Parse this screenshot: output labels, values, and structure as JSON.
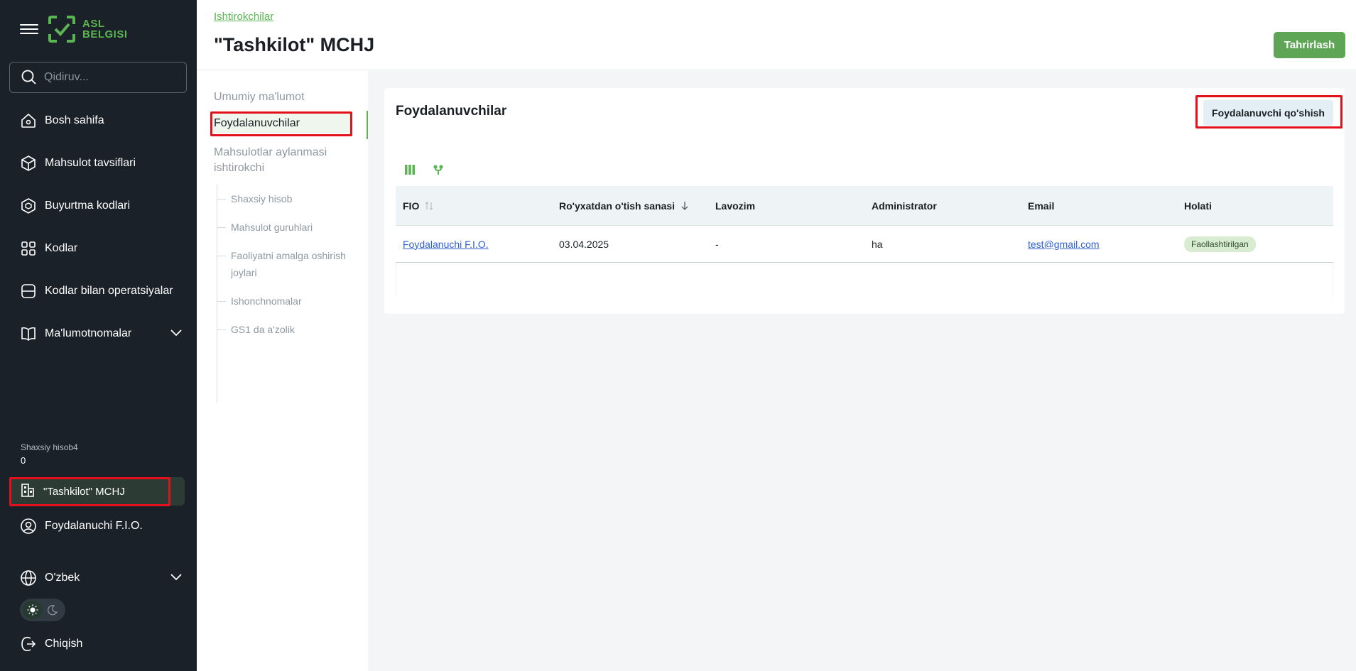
{
  "app": {
    "logo_text_1": "ASL",
    "logo_text_2": "BELGISI",
    "brand_color": "#5ab552"
  },
  "sidebar": {
    "search_placeholder": "Qidiruv...",
    "items": [
      {
        "label": "Bosh sahifa",
        "icon": "home-icon"
      },
      {
        "label": "Mahsulot tavsiflari",
        "icon": "cube-icon"
      },
      {
        "label": "Buyurtma kodlari",
        "icon": "package-icon"
      },
      {
        "label": "Kodlar",
        "icon": "qr-icon"
      },
      {
        "label": "Kodlar bilan operatsiyalar",
        "icon": "database-icon"
      },
      {
        "label": "Ma'lumotnomalar",
        "icon": "book-icon"
      }
    ],
    "account_title": "Shaxsiy hisob4",
    "account_value": "0",
    "org_label": "\"Tashkilot\" MCHJ",
    "user_label": "Foydalanuchi F.I.O.",
    "language_label": "O'zbek",
    "logout_label": "Chiqish"
  },
  "header": {
    "breadcrumb": "Ishtirokchilar",
    "title": "\"Tashkilot\" MCHJ",
    "edit_button": "Tahrirlash"
  },
  "subnav": {
    "items": [
      "Umumiy ma'lumot",
      "Foydalanuvchilar",
      "Mahsulotlar aylanmasi",
      "ishtirokchi"
    ],
    "sub_items": [
      "Shaxsiy hisob",
      "Mahsulot guruhlari",
      "Faoliyatni amalga oshirish",
      "joylari",
      "Ishonchnomalar",
      "GS1 da a'zolik"
    ]
  },
  "main": {
    "card_title": "Foydalanuvchilar",
    "add_button": "Foydalanuvchi qo'shish",
    "table": {
      "columns": [
        "FIO",
        "Ro'yxatdan o'tish sanasi",
        "Lavozim",
        "Administrator",
        "Email",
        "Holati"
      ],
      "rows": [
        [
          "Foydalanuchi F.I.O.",
          "03.04.2025",
          "-",
          "ha",
          "test@gmail.com",
          "Faollashtirilgan"
        ]
      ]
    }
  }
}
